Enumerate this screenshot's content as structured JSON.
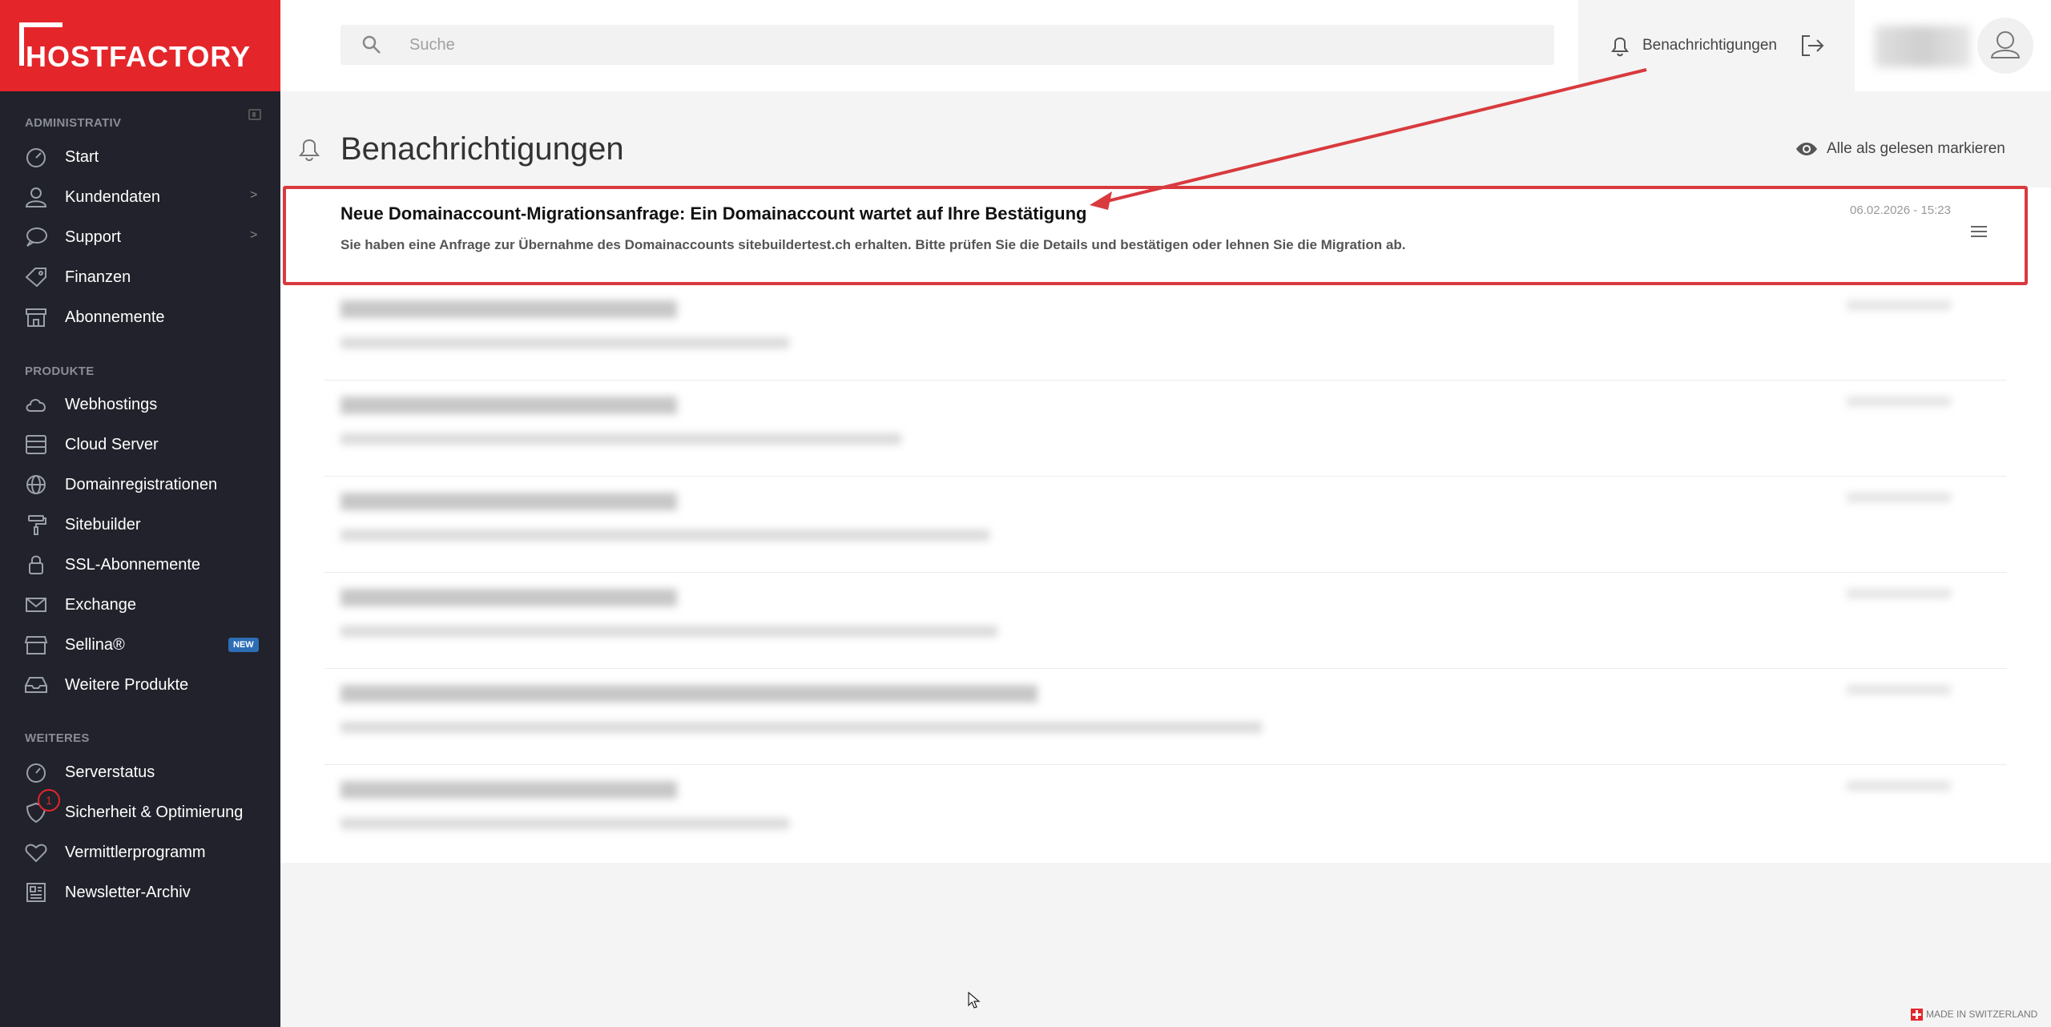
{
  "brand": {
    "name": "HOSTFACTORY",
    "color": "#e4262b"
  },
  "sidebar": {
    "sections": [
      {
        "title": "ADMINISTRATIV",
        "items": [
          {
            "label": "Start",
            "icon": "dashboard-icon"
          },
          {
            "label": "Kundendaten",
            "icon": "user-icon",
            "chevron": ">"
          },
          {
            "label": "Support",
            "icon": "chat-icon",
            "chevron": ">"
          },
          {
            "label": "Finanzen",
            "icon": "tag-icon"
          },
          {
            "label": "Abonnemente",
            "icon": "store-icon"
          }
        ]
      },
      {
        "title": "PRODUKTE",
        "items": [
          {
            "label": "Webhostings",
            "icon": "cloud-icon"
          },
          {
            "label": "Cloud Server",
            "icon": "server-icon"
          },
          {
            "label": "Domainregistrationen",
            "icon": "globe-icon"
          },
          {
            "label": "Sitebuilder",
            "icon": "paint-roller-icon"
          },
          {
            "label": "SSL-Abonnemente",
            "icon": "lock-icon"
          },
          {
            "label": "Exchange",
            "icon": "envelope-icon"
          },
          {
            "label": "Sellina®",
            "icon": "shop-icon",
            "badge": "NEW"
          },
          {
            "label": "Weitere Produkte",
            "icon": "inbox-icon"
          }
        ]
      },
      {
        "title": "WEITERES",
        "items": [
          {
            "label": "Serverstatus",
            "icon": "gauge-icon"
          },
          {
            "label": "Sicherheit & Optimierung",
            "icon": "shield-icon",
            "count": "1"
          },
          {
            "label": "Vermittlerprogramm",
            "icon": "heart-icon"
          },
          {
            "label": "Newsletter-Archiv",
            "icon": "newspaper-icon"
          }
        ]
      }
    ]
  },
  "header": {
    "search_placeholder": "Suche",
    "notifications_label": "Benachrichtigungen"
  },
  "page": {
    "title": "Benachrichtigungen",
    "mark_all_read": "Alle als gelesen markieren"
  },
  "notifications": [
    {
      "title": "Neue Domainaccount-Migrationsanfrage: Ein Domainaccount wartet auf Ihre Bestätigung",
      "description": "Sie haben eine Anfrage zur Übernahme des Domainaccounts sitebuildertest.ch erhalten. Bitte prüfen Sie die Details und bestätigen oder lehnen Sie die Migration ab.",
      "timestamp": "06.02.2026 - 15:23"
    }
  ],
  "footer": {
    "label": "MADE IN SWITZERLAND"
  }
}
